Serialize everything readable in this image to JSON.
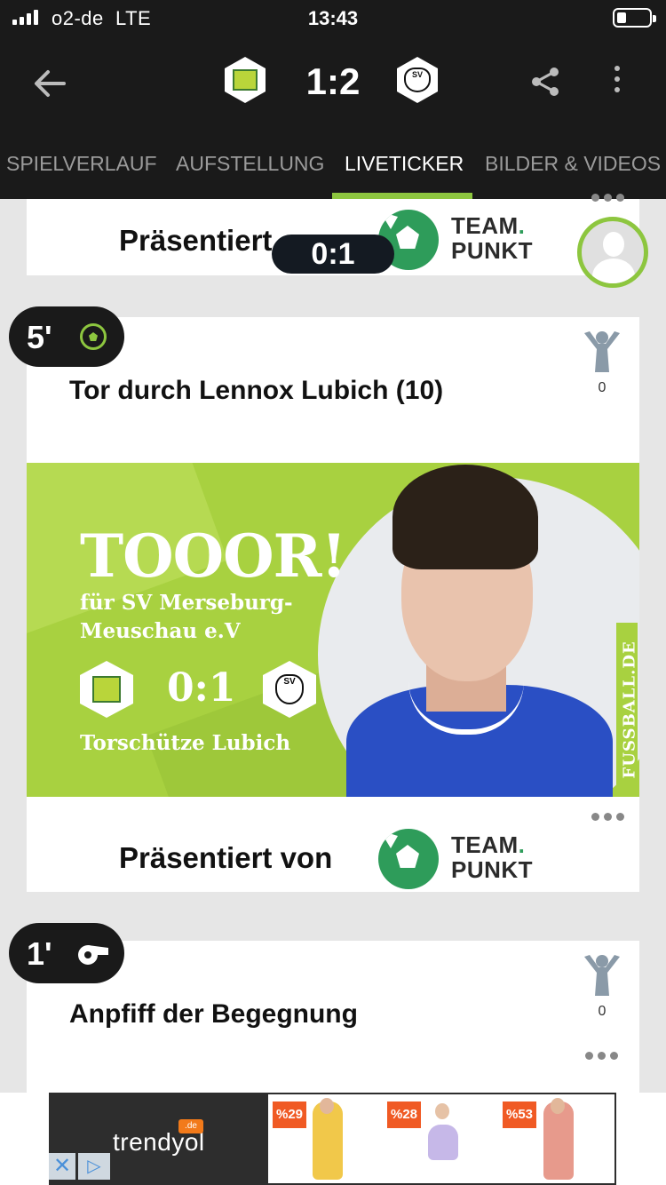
{
  "status_bar": {
    "carrier": "o2-de",
    "network": "LTE",
    "time": "13:43"
  },
  "header": {
    "score": "1:2",
    "home_logo_text": "",
    "away_logo_text": "SV"
  },
  "tabs": [
    {
      "label": "SPIELVERLAUF",
      "active": false
    },
    {
      "label": "AUFSTELLUNG",
      "active": false
    },
    {
      "label": "LIVETICKER",
      "active": true
    },
    {
      "label": "BILDER & VIDEOS",
      "active": false
    }
  ],
  "sponsor": {
    "presented_label": "Präsentiert von",
    "presented_label_cut": "Präsentiert",
    "brand_line1": "TEAM",
    "brand_dot": ".",
    "brand_line2": "PUNKT"
  },
  "floating_score": "0:1",
  "events": [
    {
      "minute": "5'",
      "icon": "soccer-ball-icon",
      "title": "Tor durch Lennox Lubich (10)",
      "cheer_count": "0",
      "graphic": {
        "headline": "TOOOR!",
        "subline": "für SV Merseburg-Meuschau e.V",
        "score": "0:1",
        "scorer": "Torschütze Lubich",
        "watermark": "FUSSBALL.DE"
      }
    },
    {
      "minute": "1'",
      "icon": "whistle-icon",
      "title": "Anpfiff der Begegnung",
      "cheer_count": "0"
    }
  ],
  "ad": {
    "brand": "trendyol",
    "brand_tld": ".de",
    "discounts": [
      "%29",
      "%28",
      "%53"
    ]
  },
  "colors": {
    "accent": "#8dc63f",
    "header_bg": "#1a1a1a",
    "teampunkt_green": "#2e9c5a",
    "ad_badge": "#f05a24"
  }
}
